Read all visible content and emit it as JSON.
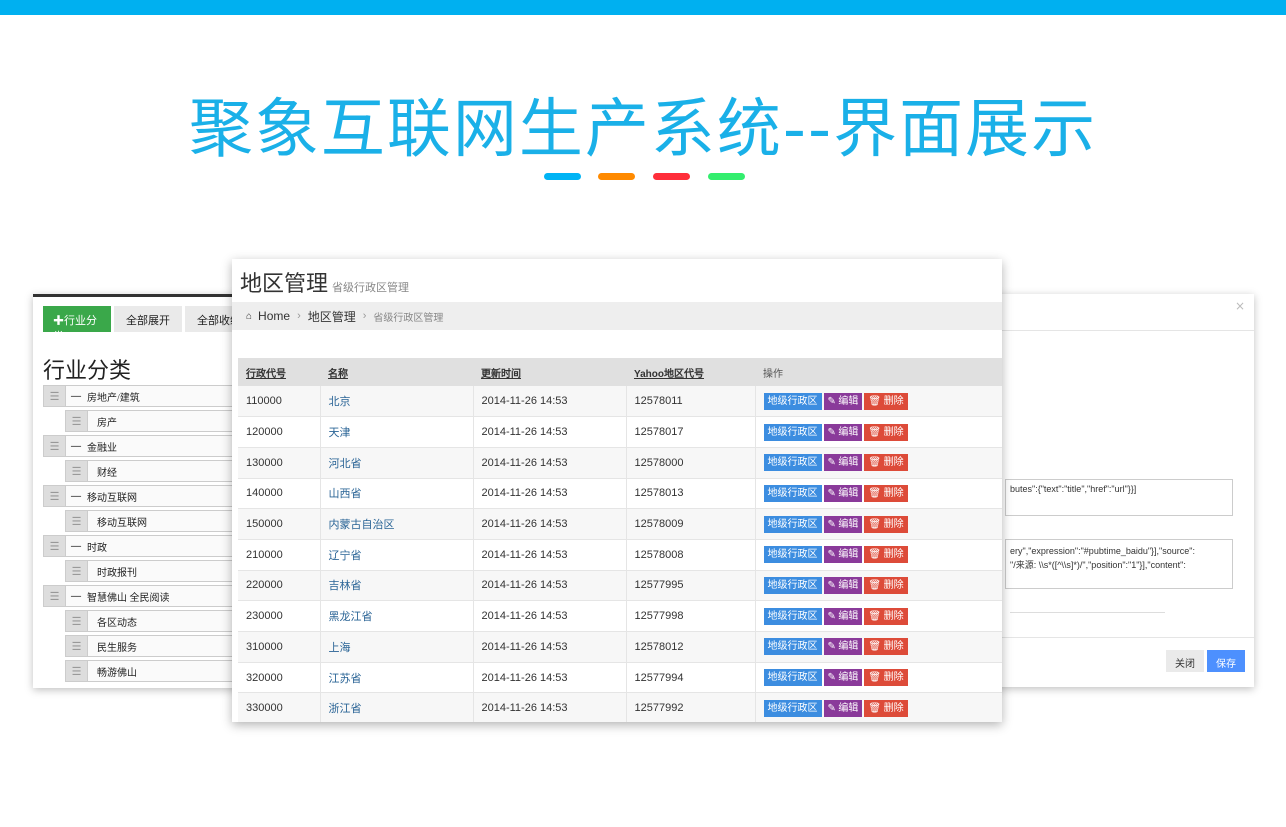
{
  "page": {
    "title": "聚象互联网生产系统--界面展示",
    "dash_colors": [
      "#00b4f5",
      "#ff8a00",
      "#ff2e3a",
      "#33ee6e"
    ]
  },
  "left_panel": {
    "add_btn": "✚行业分类",
    "expand_btn": "全部展开",
    "collapse_btn": "全部收缩",
    "heading": "行业分类",
    "tree": [
      {
        "label": "房地产/建筑",
        "children": [
          "房产"
        ]
      },
      {
        "label": "金融业",
        "children": [
          "财经"
        ]
      },
      {
        "label": "移动互联网",
        "children": [
          "移动互联网"
        ]
      },
      {
        "label": "时政",
        "children": [
          "时政报刊"
        ]
      },
      {
        "label": "智慧佛山 全民阅读",
        "children": [
          "各区动态",
          "民生服务",
          "畅游佛山"
        ]
      }
    ]
  },
  "right_panel": {
    "close": "×",
    "box1": "butes\":{\"text\":\"title\",\"href\":\"url\"}}]",
    "box2_line1": "ery\",\"expression\":\"#pubtime_baidu\"}],\"source\":",
    "box2_line2": "\"/来源: \\\\s*([^\\\\s]*)/\",\"position\":\"1\"}],\"content\":",
    "close_btn": "关闭",
    "save_btn": "保存"
  },
  "main_panel": {
    "title": "地区管理",
    "subtitle": "省级行政区管理",
    "breadcrumb": {
      "home": "Home",
      "level1": "地区管理",
      "level2": "省级行政区管理"
    },
    "columns": [
      "行政代号",
      "名称",
      "更新时间",
      "Yahoo地区代号",
      "操作"
    ],
    "action_labels": {
      "sub": "地级行政区",
      "edit": "编辑",
      "delete": "删除"
    },
    "rows": [
      {
        "code": "110000",
        "name": "北京",
        "updated": "2014-11-26 14:53",
        "yahoo": "12578011"
      },
      {
        "code": "120000",
        "name": "天津",
        "updated": "2014-11-26 14:53",
        "yahoo": "12578017"
      },
      {
        "code": "130000",
        "name": "河北省",
        "updated": "2014-11-26 14:53",
        "yahoo": "12578000"
      },
      {
        "code": "140000",
        "name": "山西省",
        "updated": "2014-11-26 14:53",
        "yahoo": "12578013"
      },
      {
        "code": "150000",
        "name": "内蒙古自治区",
        "updated": "2014-11-26 14:53",
        "yahoo": "12578009"
      },
      {
        "code": "210000",
        "name": "辽宁省",
        "updated": "2014-11-26 14:53",
        "yahoo": "12578008"
      },
      {
        "code": "220000",
        "name": "吉林省",
        "updated": "2014-11-26 14:53",
        "yahoo": "12577995"
      },
      {
        "code": "230000",
        "name": "黑龙江省",
        "updated": "2014-11-26 14:53",
        "yahoo": "12577998"
      },
      {
        "code": "310000",
        "name": "上海",
        "updated": "2014-11-26 14:53",
        "yahoo": "12578012"
      },
      {
        "code": "320000",
        "name": "江苏省",
        "updated": "2014-11-26 14:53",
        "yahoo": "12577994"
      },
      {
        "code": "330000",
        "name": "浙江省",
        "updated": "2014-11-26 14:53",
        "yahoo": "12577992"
      }
    ]
  }
}
